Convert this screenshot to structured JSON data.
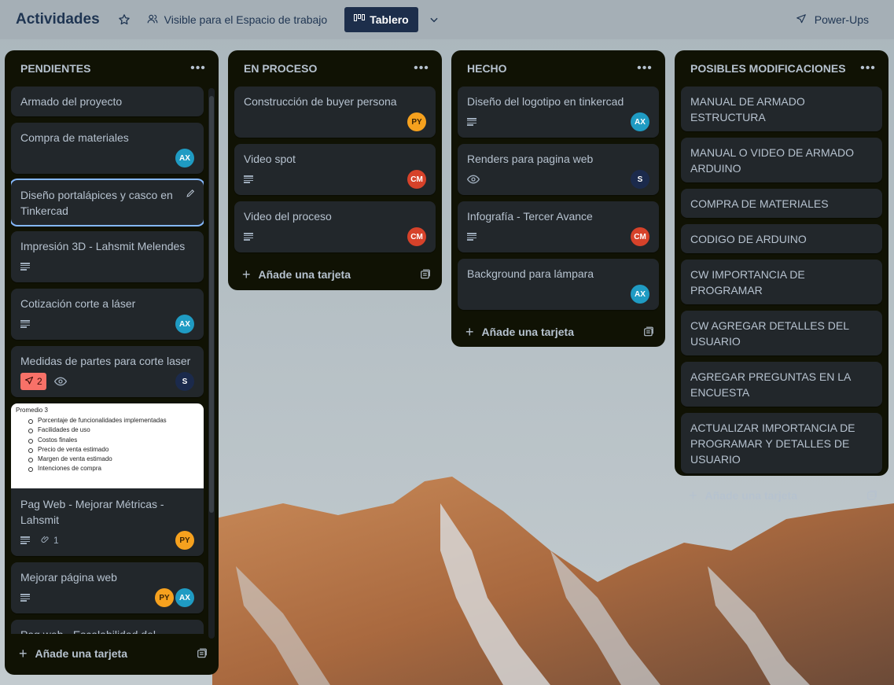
{
  "header": {
    "board_title": "Actividades",
    "visibility_label": "Visible para el Espacio de trabajo",
    "view_label": "Tablero",
    "powerups_label": "Power-Ups"
  },
  "colors": {
    "header_dark": "#1d2e4b",
    "list_bg": "#101204",
    "card_bg": "#22272b",
    "avatar_ax": "#1f9bc3",
    "avatar_py": "#f6a11e",
    "avatar_cm": "#d6422a",
    "avatar_s": "#1b2a4c",
    "due_badge": "#f87168"
  },
  "add_card_label": "Añade una tarjeta",
  "lists": [
    {
      "title": "PENDIENTES",
      "cards": [
        {
          "title": "Armado del proyecto"
        },
        {
          "title": "Compra de materiales",
          "avatars": [
            "AX"
          ]
        },
        {
          "title": "Diseño portalápices y casco en Tinkercad"
        },
        {
          "title": "Impresión 3D - Lahsmit Melendes"
        },
        {
          "title": "Cotización corte a láser",
          "avatars": [
            "AX"
          ]
        },
        {
          "title": "Medidas de partes para corte laser",
          "badge": "2",
          "avatars": [
            "S"
          ]
        },
        {
          "title": "Pag Web - Mejorar Métricas - Lahsmit",
          "attachments": "1",
          "avatars": [
            "PY"
          ],
          "cover": {
            "heading": "Promedio 3",
            "items": [
              "Porcentaje de funcionalidades implementadas",
              "Facilidades de uso",
              "Costos finales",
              "Precio de venta estimado",
              "Margen de venta estimado",
              "Intenciones de compra"
            ]
          }
        },
        {
          "title": "Mejorar página web",
          "avatars": [
            "PY",
            "AX"
          ]
        },
        {
          "title": "Pag web - Escalabilidad del"
        }
      ]
    },
    {
      "title": "EN PROCESO",
      "cards": [
        {
          "title": "Construcción de buyer persona",
          "avatars": [
            "PY"
          ]
        },
        {
          "title": "Video spot",
          "avatars": [
            "CM"
          ]
        },
        {
          "title": "Video del proceso",
          "avatars": [
            "CM"
          ]
        }
      ]
    },
    {
      "title": "HECHO",
      "cards": [
        {
          "title": "Diseño del logotipo en tinkercad",
          "avatars": [
            "AX"
          ]
        },
        {
          "title": "Renders para pagina web",
          "avatars": [
            "S"
          ]
        },
        {
          "title": "Infografía - Tercer Avance",
          "avatars": [
            "CM"
          ]
        },
        {
          "title": "Background para lámpara",
          "avatars": [
            "AX"
          ]
        }
      ]
    },
    {
      "title": "POSIBLES MODIFICACIONES",
      "cards": [
        {
          "title": "MANUAL DE ARMADO ESTRUCTURA"
        },
        {
          "title": "MANUAL O VIDEO DE ARMADO ARDUINO"
        },
        {
          "title": "COMPRA DE MATERIALES"
        },
        {
          "title": "CODIGO DE ARDUINO"
        },
        {
          "title": "CW IMPORTANCIA DE PROGRAMAR"
        },
        {
          "title": "CW AGREGAR DETALLES DEL USUARIO"
        },
        {
          "title": "AGREGAR PREGUNTAS EN LA ENCUESTA"
        },
        {
          "title": "ACTUALIZAR IMPORTANCIA DE PROGRAMAR Y DETALLES DE USUARIO"
        }
      ]
    }
  ]
}
